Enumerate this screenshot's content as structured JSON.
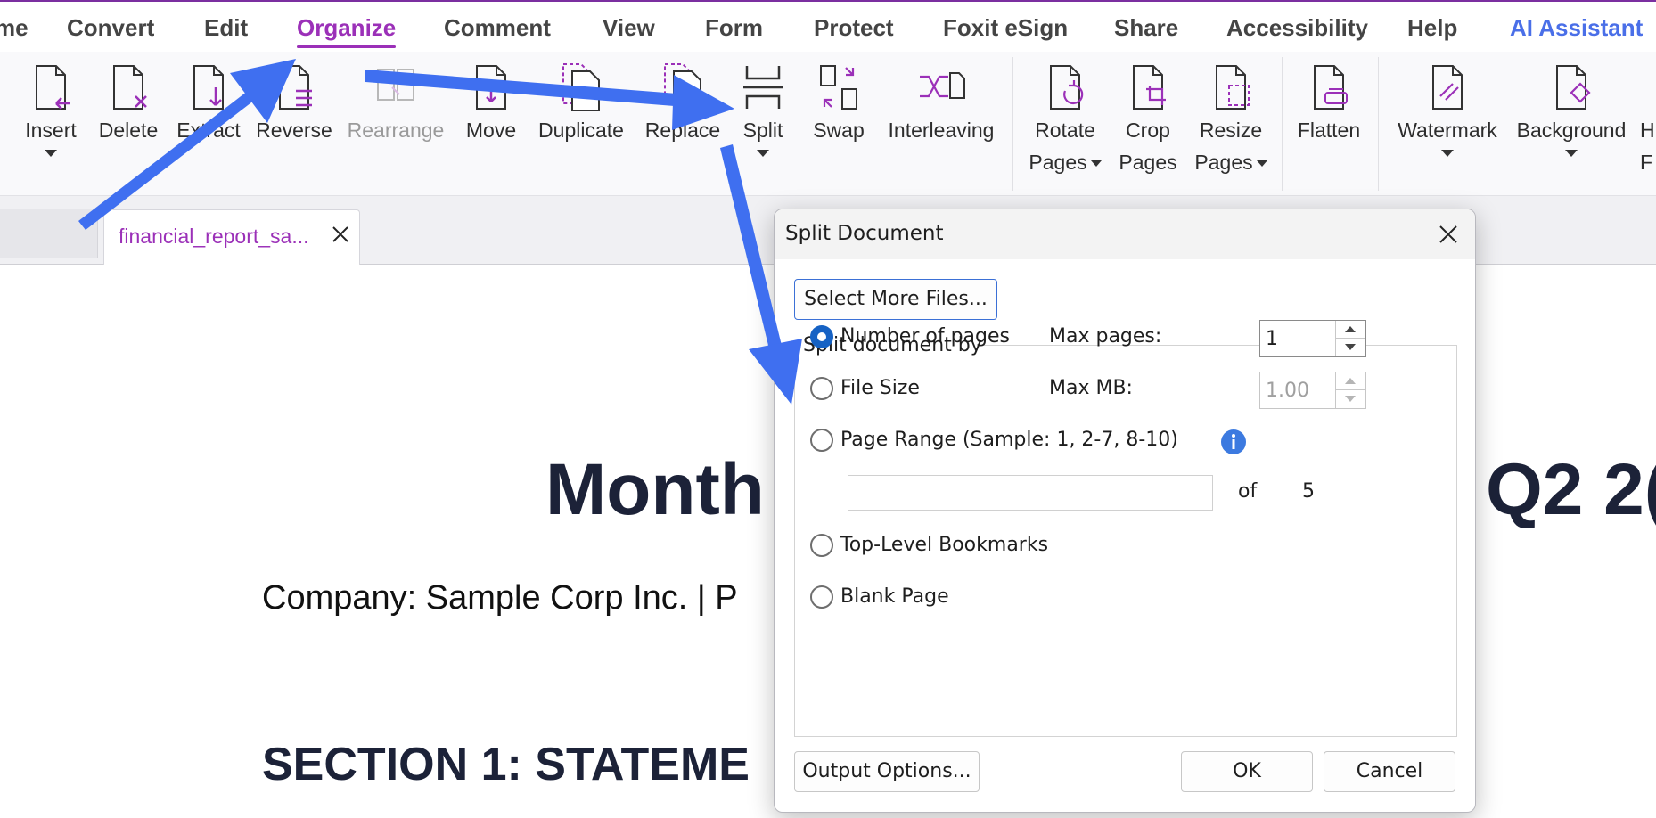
{
  "menu": {
    "items": [
      {
        "label": "me",
        "state": "normal"
      },
      {
        "label": "Convert",
        "state": "normal"
      },
      {
        "label": "Edit",
        "state": "normal"
      },
      {
        "label": "Organize",
        "state": "active"
      },
      {
        "label": "Comment",
        "state": "normal"
      },
      {
        "label": "View",
        "state": "normal"
      },
      {
        "label": "Form",
        "state": "normal"
      },
      {
        "label": "Protect",
        "state": "normal"
      },
      {
        "label": "Foxit eSign",
        "state": "normal"
      },
      {
        "label": "Share",
        "state": "normal"
      },
      {
        "label": "Accessibility",
        "state": "normal"
      },
      {
        "label": "Help",
        "state": "normal"
      },
      {
        "label": "AI Assistant",
        "state": "ai"
      }
    ]
  },
  "ribbon": {
    "insert": "Insert",
    "delete": "Delete",
    "extract": "Extract",
    "reverse": "Reverse",
    "rearrange": "Rearrange",
    "move": "Move",
    "duplicate": "Duplicate",
    "replace": "Replace",
    "split": "Split",
    "swap": "Swap",
    "interleaving": "Interleaving",
    "rotate_1": "Rotate",
    "rotate_2": "Pages",
    "crop_1": "Crop",
    "crop_2": "Pages",
    "resize_1": "Resize",
    "resize_2": "Pages",
    "flatten": "Flatten",
    "watermark": "Watermark",
    "background": "Background",
    "header_partial_1": "H",
    "header_partial_2": "F"
  },
  "tabs": {
    "active_title": "financial_report_sa..."
  },
  "document": {
    "title_left": "Month",
    "title_right": "Q2 2(",
    "company_line": "Company: Sample Corp Inc. | P",
    "section_heading": "SECTION 1: STATEME"
  },
  "dialog": {
    "title": "Split Document",
    "select_more": "Select More Files...",
    "group_label": "Split document by",
    "options": {
      "number_of_pages": "Number of pages",
      "file_size": "File Size",
      "page_range": "Page Range (Sample: 1, 2-7, 8-10)",
      "top_level_bookmarks": "Top-Level Bookmarks",
      "blank_page": "Blank Page"
    },
    "selected_option": "number_of_pages",
    "max_pages_label": "Max pages:",
    "max_pages_value": "1",
    "max_mb_label": "Max MB:",
    "max_mb_value": "1.00",
    "range_value": "",
    "of_label": "of",
    "total_pages": "5",
    "output_options": "Output Options...",
    "ok": "OK",
    "cancel": "Cancel"
  },
  "colors": {
    "accent": "#9b30b8",
    "ai_blue": "#4a6fe8",
    "radio_selected": "#1662c4",
    "annotation_arrow": "#3f6ff0",
    "info_icon": "#3c7ae0",
    "doc_heading": "#1c2238"
  }
}
